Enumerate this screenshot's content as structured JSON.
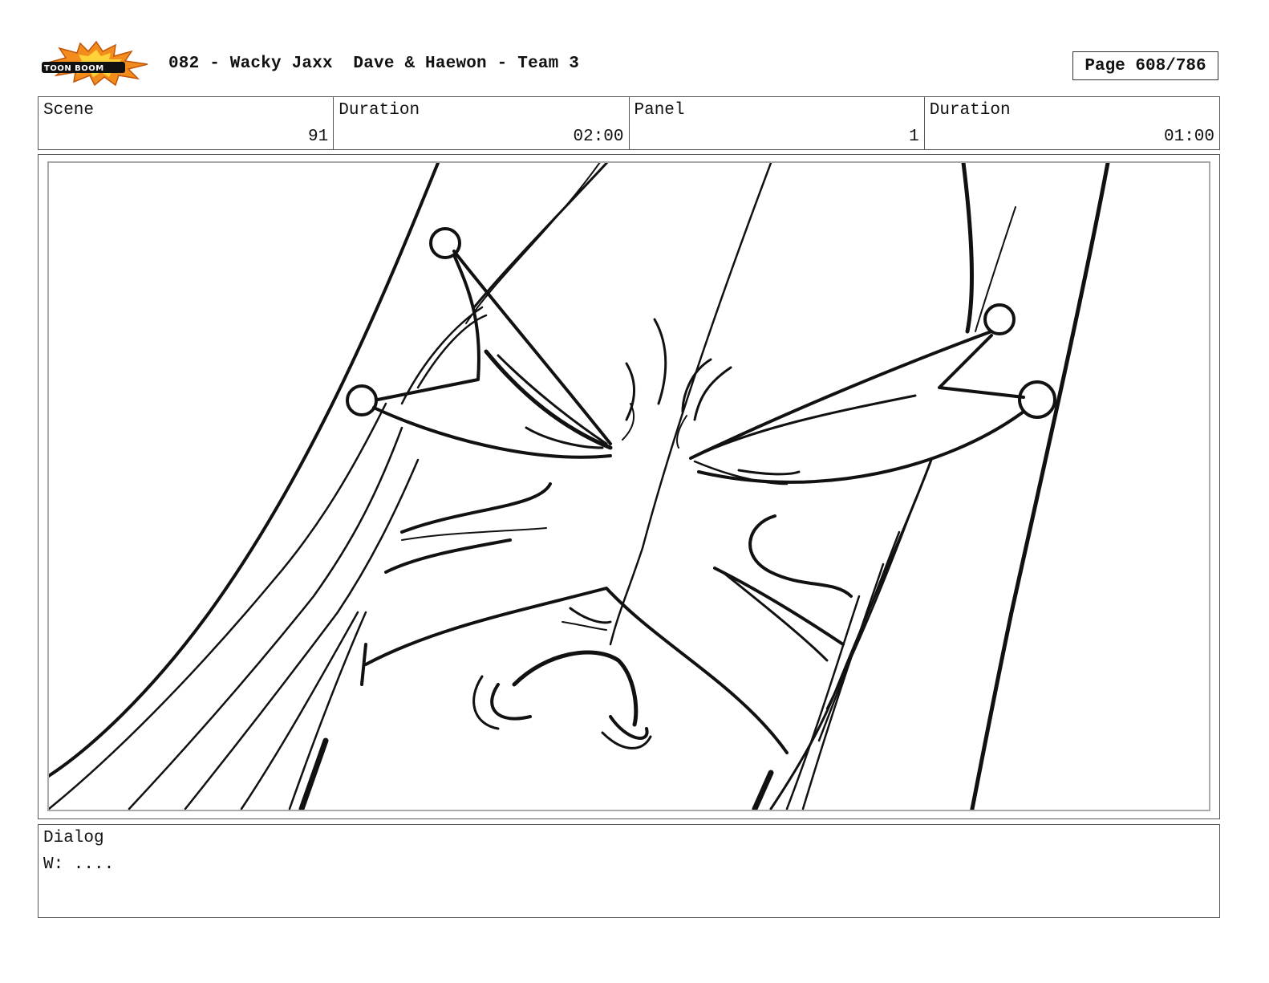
{
  "header": {
    "logo_icon": "toon-boom-logo",
    "logo_text": "TOON BOOM",
    "title": "082 - Wacky Jaxx  Dave & Haewon - Team 3",
    "page": "Page 608/786"
  },
  "info": {
    "scene_label": "Scene",
    "scene_value": "91",
    "scene_duration_label": "Duration",
    "scene_duration_value": "02:00",
    "panel_label": "Panel",
    "panel_value": "1",
    "panel_duration_label": "Duration",
    "panel_duration_value": "01:00"
  },
  "panel": {
    "image_icon": "storyboard-sketch-closeup-face"
  },
  "dialog": {
    "label": "Dialog",
    "text": "W: ...."
  },
  "colors": {
    "logo_orange": "#f28c1c",
    "logo_yellow": "#ffd23a",
    "border": "#555555",
    "inner_border": "#aaaaaa"
  }
}
